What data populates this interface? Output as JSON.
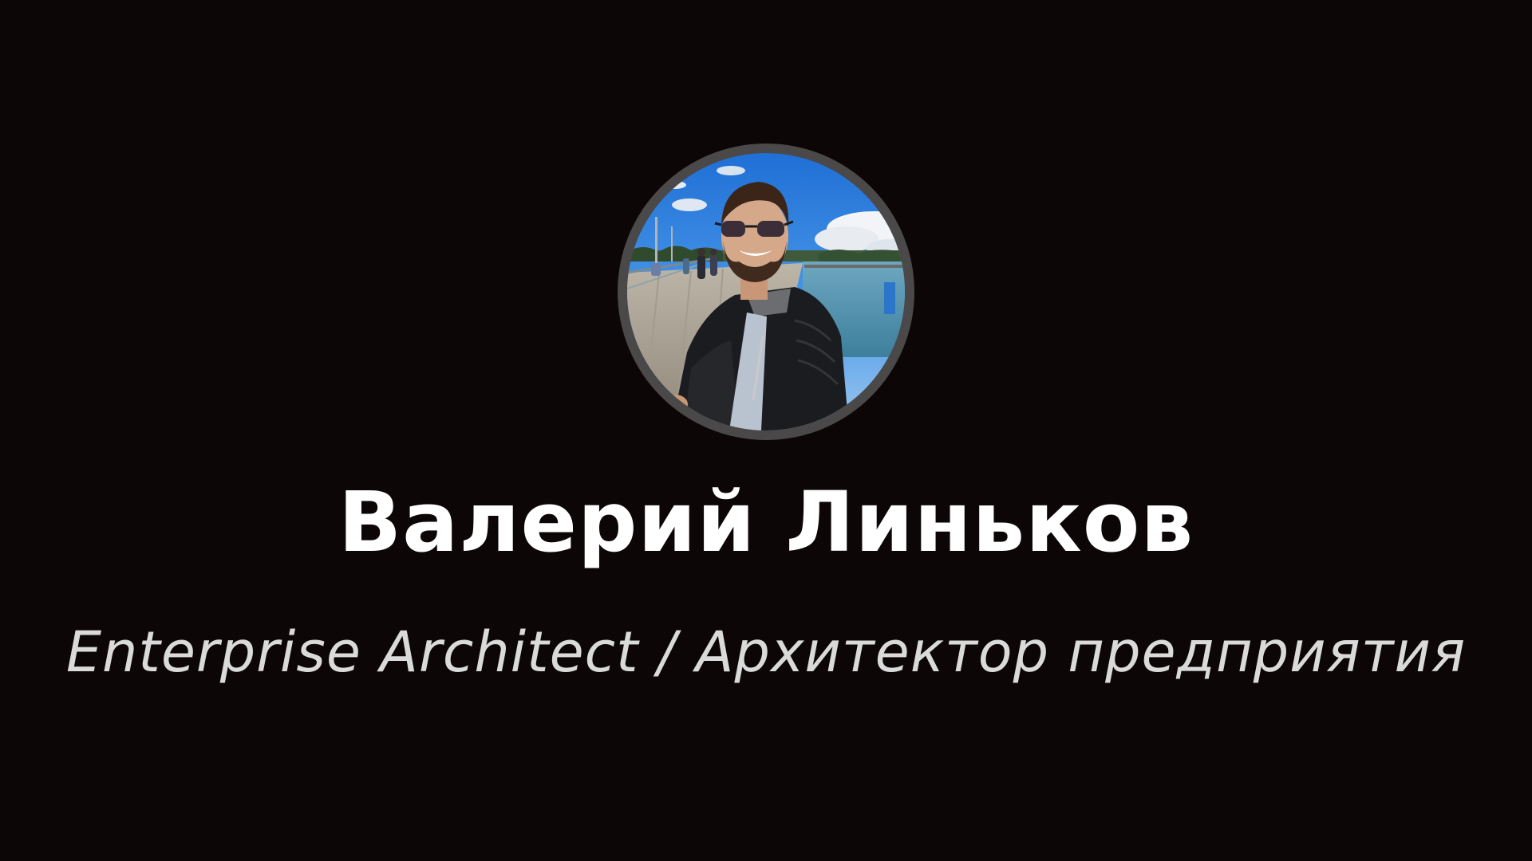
{
  "profile": {
    "name": "Валерий Линьков",
    "role": "Enterprise Architect / Архитектор предприятия",
    "photo_icon": "person-portrait-photo"
  },
  "colors": {
    "background": "#0d0606",
    "avatar_ring": "#4a4848",
    "name_text": "#ffffff",
    "role_text": "#e6e6e6"
  }
}
